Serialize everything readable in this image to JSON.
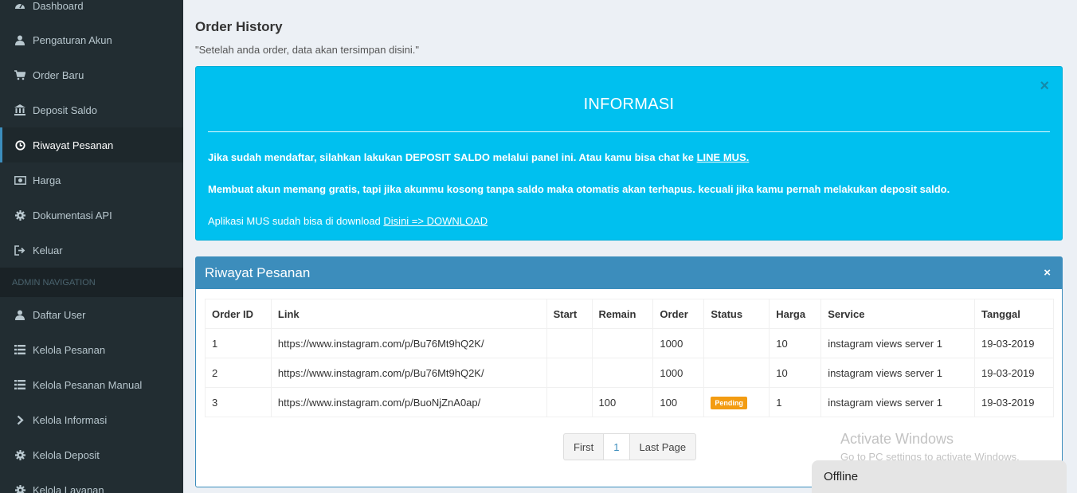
{
  "sidebar": {
    "items": [
      {
        "label": "Dashboard",
        "icon": "dashboard-icon"
      },
      {
        "label": "Pengaturan Akun",
        "icon": "user-icon"
      },
      {
        "label": "Order Baru",
        "icon": "cart-icon"
      },
      {
        "label": "Deposit Saldo",
        "icon": "bank-icon"
      },
      {
        "label": "Riwayat Pesanan",
        "icon": "clock-icon"
      },
      {
        "label": "Harga",
        "icon": "money-icon"
      },
      {
        "label": "Dokumentasi API",
        "icon": "gear-icon"
      },
      {
        "label": "Keluar",
        "icon": "sign-out-icon"
      }
    ],
    "admin_header": "ADMIN NAVIGATION",
    "admin_items": [
      {
        "label": "Daftar User",
        "icon": "user-icon"
      },
      {
        "label": "Kelola Pesanan",
        "icon": "list-icon"
      },
      {
        "label": "Kelola Pesanan Manual",
        "icon": "list-icon"
      },
      {
        "label": "Kelola Informasi",
        "icon": "chevron-right-icon"
      },
      {
        "label": "Kelola Deposit",
        "icon": "gear-icon"
      },
      {
        "label": "Kelola Layanan",
        "icon": "gear-icon"
      }
    ],
    "active": "Riwayat Pesanan"
  },
  "page": {
    "title": "Order History",
    "subtitle": "\"Setelah anda order, data akan tersimpan disini.\""
  },
  "info": {
    "title": "INFORMASI",
    "close": "×",
    "line1_text": "Jika sudah mendaftar, silahkan lakukan DEPOSIT SALDO melalui panel ini. Atau kamu bisa chat ke ",
    "line1_link": "LINE MUS.",
    "line2": "Membuat akun memang gratis, tapi jika akunmu kosong tanpa saldo maka otomatis akan terhapus. kecuali jika kamu pernah melakukan deposit saldo.",
    "line3_text": "Aplikasi MUS sudah bisa di download ",
    "line3_link": "Disini => DOWNLOAD"
  },
  "orders": {
    "title": "Riwayat Pesanan",
    "close": "×",
    "columns": [
      "Order ID",
      "Link",
      "Start",
      "Remain",
      "Order",
      "Status",
      "Harga",
      "Service",
      "Tanggal"
    ],
    "rows": [
      {
        "id": "1",
        "link": "https://www.instagram.com/p/Bu76Mt9hQ2K/",
        "start": "",
        "remain": "",
        "order": "1000",
        "status": "",
        "harga": "10",
        "service": "instagram views server 1",
        "tanggal": "19-03-2019"
      },
      {
        "id": "2",
        "link": "https://www.instagram.com/p/Bu76Mt9hQ2K/",
        "start": "",
        "remain": "",
        "order": "1000",
        "status": "",
        "harga": "10",
        "service": "instagram views server 1",
        "tanggal": "19-03-2019"
      },
      {
        "id": "3",
        "link": "https://www.instagram.com/p/BuoNjZnA0ap/",
        "start": "",
        "remain": "100",
        "order": "100",
        "status": "Pending",
        "harga": "1",
        "service": "instagram views server 1",
        "tanggal": "19-03-2019"
      }
    ],
    "pagination": {
      "first": "First",
      "current": "1",
      "last": "Last Page"
    }
  },
  "watermark": {
    "line1": "Activate Windows",
    "line2": "Go to PC settings to activate Windows."
  },
  "chat": {
    "label": "Offline"
  },
  "colors": {
    "sidebar": "#222d32",
    "accent": "#3c8dbc",
    "info": "#00c0ef",
    "pending": "#f39c12"
  }
}
